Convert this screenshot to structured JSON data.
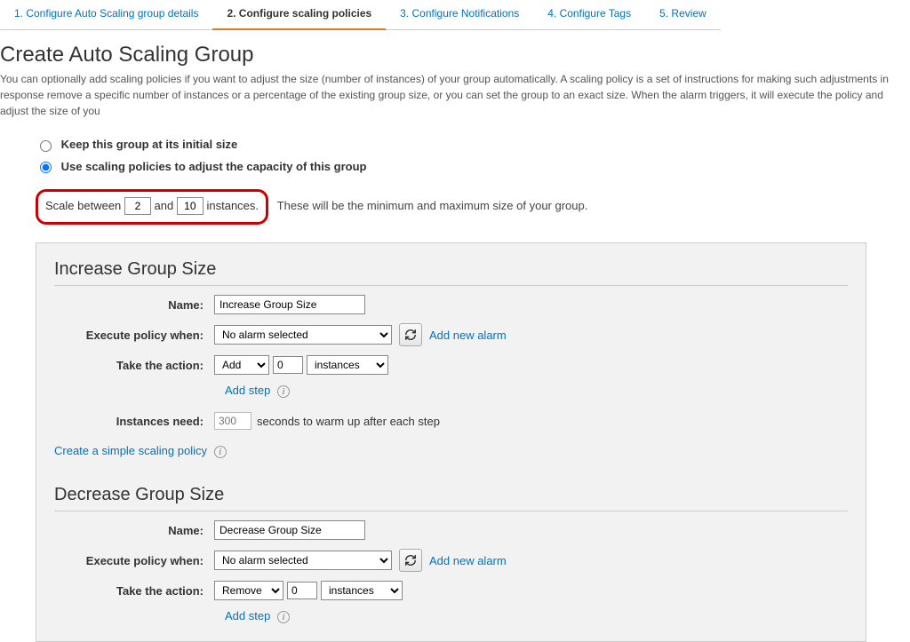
{
  "wizard": {
    "steps": [
      "1. Configure Auto Scaling group details",
      "2. Configure scaling policies",
      "3. Configure Notifications",
      "4. Configure Tags",
      "5. Review"
    ],
    "active_index": 1
  },
  "page": {
    "title": "Create Auto Scaling Group",
    "description": "You can optionally add scaling policies if you want to adjust the size (number of instances) of your group automatically. A scaling policy is a set of instructions for making such adjustments in response remove a specific number of instances or a percentage of the existing group size, or you can set the group to an exact size. When the alarm triggers, it will execute the policy and adjust the size of you"
  },
  "radios": {
    "keep_initial": "Keep this group at its initial size",
    "use_policies": "Use scaling policies to adjust the capacity of this group"
  },
  "scale_between": {
    "prefix": "Scale between",
    "min": "2",
    "and": "and",
    "max": "10",
    "suffix": "instances.",
    "hint": "These will be the minimum and maximum size of your group."
  },
  "labels": {
    "name": "Name:",
    "execute_when": "Execute policy when:",
    "take_action": "Take the action:",
    "instances_need": "Instances need:",
    "add_new_alarm": "Add new alarm",
    "add_step": "Add step",
    "warmup_suffix": "seconds to warm up after each step",
    "simple_policy": "Create a simple scaling policy"
  },
  "increase": {
    "heading": "Increase Group Size",
    "name_value": "Increase Group Size",
    "alarm_selected": "No alarm selected",
    "action": "Add",
    "amount": "0",
    "unit": "instances",
    "warmup_placeholder": "300"
  },
  "decrease": {
    "heading": "Decrease Group Size",
    "name_value": "Decrease Group Size",
    "alarm_selected": "No alarm selected",
    "action": "Remove",
    "amount": "0",
    "unit": "instances"
  }
}
